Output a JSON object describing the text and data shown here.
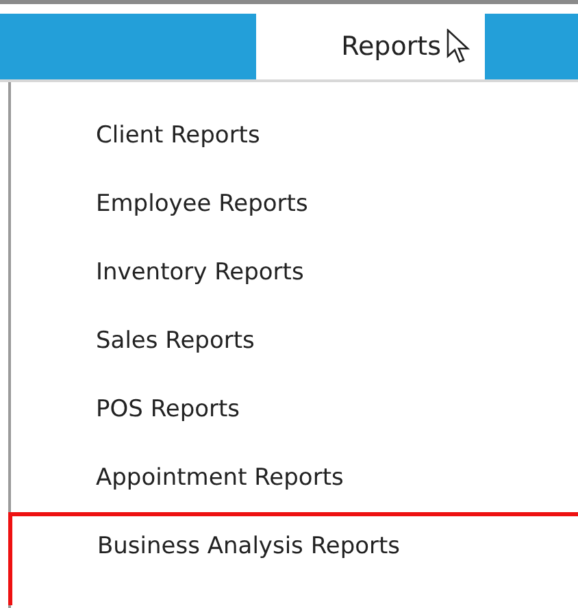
{
  "menu_bar": {
    "tab": {
      "label": "Reports",
      "selected": true
    }
  },
  "dropdown": {
    "items": [
      {
        "label": "Client Reports",
        "highlighted": false
      },
      {
        "label": "Employee Reports",
        "highlighted": false
      },
      {
        "label": "Inventory Reports",
        "highlighted": false
      },
      {
        "label": "Sales Reports",
        "highlighted": false
      },
      {
        "label": "POS Reports",
        "highlighted": false
      },
      {
        "label": "Appointment Reports",
        "highlighted": false
      },
      {
        "label": "Business Analysis Reports",
        "highlighted": true
      }
    ]
  }
}
